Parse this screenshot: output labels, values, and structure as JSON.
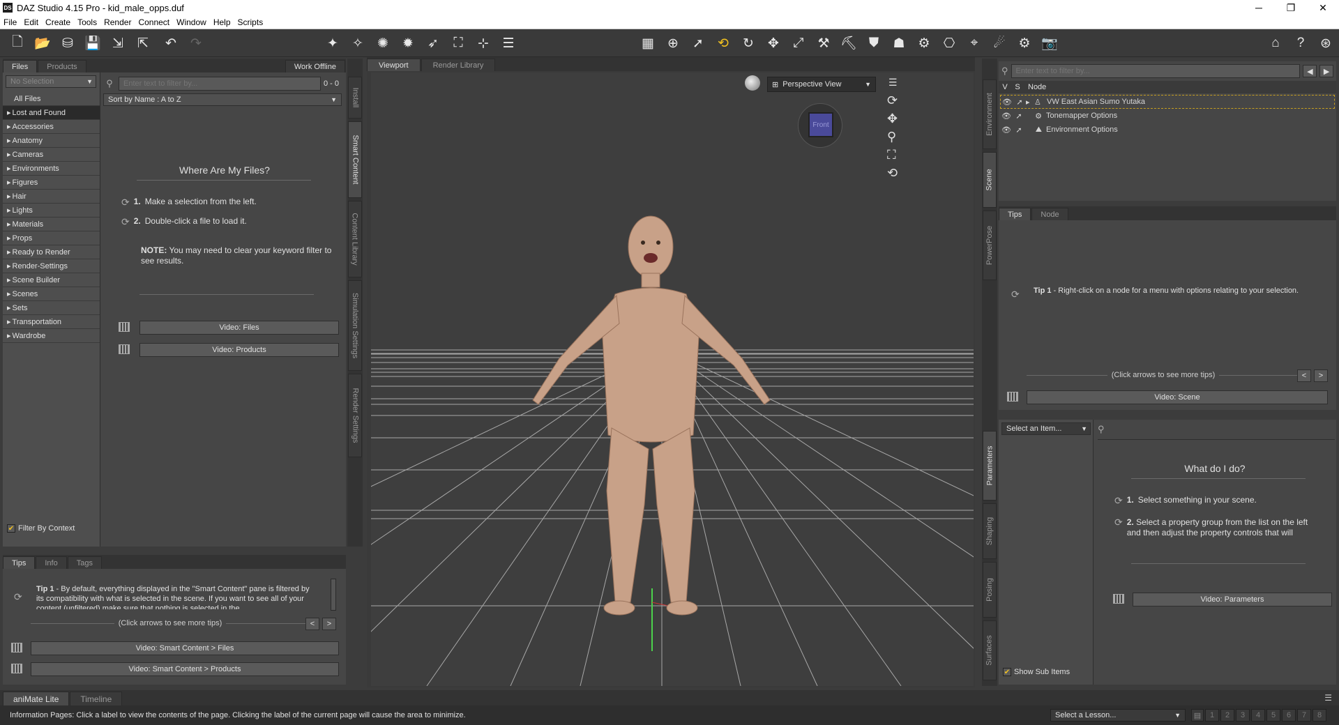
{
  "window": {
    "title": "DAZ Studio 4.15 Pro - kid_male_opps.duf",
    "app_badge": "DS",
    "minimize": "─",
    "restore": "❐",
    "close": "✕"
  },
  "menu": [
    "File",
    "Edit",
    "Create",
    "Tools",
    "Render",
    "Connect",
    "Window",
    "Help",
    "Scripts"
  ],
  "toolbar_icons": [
    "new-file-icon",
    "open-icon",
    "merge-icon",
    "save-icon",
    "import-icon",
    "export-icon",
    "undo-icon",
    "redo-icon",
    "create-figure-icon",
    "create-light-icon",
    "create-spot-icon",
    "create-point-icon",
    "create-distant-icon",
    "create-camera-icon",
    "create-null-icon",
    "align-icon",
    "scene-tool-icon",
    "rotate-icon",
    "select-tool-icon",
    "universal-tool-icon",
    "node-rotate-icon",
    "translate-icon",
    "scale-icon",
    "joint-editor-icon",
    "geometry-editor-icon",
    "surface-selection-icon",
    "weight-map-icon",
    "figure-setup-icon",
    "camera-icon",
    "region-nav-icon",
    "active-pose-icon",
    "render-settings-icon",
    "render-icon",
    "daz-connect-icon",
    "help-icon",
    "whats-this-icon"
  ],
  "left_panel": {
    "tabs": [
      "Files",
      "Products"
    ],
    "work_offline": "Work Offline",
    "selection": "No Selection",
    "filter_placeholder": "Enter text to filter by...",
    "count": "0 - 0",
    "sort": "Sort by Name : A to Z",
    "categories": [
      "All Files",
      "Lost and Found",
      "Accessories",
      "Anatomy",
      "Cameras",
      "Environments",
      "Figures",
      "Hair",
      "Lights",
      "Materials",
      "Props",
      "Ready to Render",
      "Render-Settings",
      "Scene Builder",
      "Scenes",
      "Sets",
      "Transportation",
      "Wardrobe"
    ],
    "where_title": "Where Are My Files?",
    "step1_num": "1.",
    "step1": "Make a selection from the left.",
    "step2_num": "2.",
    "step2": "Double-click a file to load it.",
    "note_label": "NOTE:",
    "note": "You may need to clear your keyword filter to see results.",
    "video_files": "Video: Files",
    "video_products": "Video:  Products",
    "filter_context": "Filter By Context",
    "side_tabs": [
      "Install",
      "Smart Content",
      "Content Library",
      "Simulation Settings",
      "Render Settings"
    ]
  },
  "left_bottom": {
    "tabs": [
      "Tips",
      "Info",
      "Tags"
    ],
    "tip_label": "Tip 1",
    "tip_text": " - By default, everything displayed in the \"Smart Content\" pane is filtered by its compatibility with what is selected in the scene. If you want to see all of your content (unfiltered) make sure that nothing is selected in the",
    "more_tips": "(Click arrows to see more tips)",
    "prev": "<",
    "next": ">",
    "video1": "Video: Smart Content > Files",
    "video2": "Video: Smart Content > Products"
  },
  "viewport": {
    "tabs": [
      "Viewport",
      "Render Library"
    ],
    "view_mode": "Perspective View",
    "cube_face": "Front"
  },
  "scene": {
    "filter_placeholder": "Enter text to filter by...",
    "cols": [
      "V",
      "S",
      "Node"
    ],
    "nodes": [
      "VW East Asian Sumo Yutaka",
      "Tonemapper Options",
      "Environment Options"
    ],
    "side_tabs": [
      "Environment",
      "Scene",
      "PowerPose"
    ],
    "tabs": [
      "Tips",
      "Node"
    ],
    "tip_label": "Tip 1",
    "tip_text": " - Right-click on a node for a menu with options relating to your selection.",
    "more_tips": "(Click arrows to see more tips)",
    "prev": "<",
    "next": ">",
    "video": "Video: Scene"
  },
  "params": {
    "select": "Select an Item...",
    "title": "What do I do?",
    "step1_num": "1.",
    "step1": "Select something in your scene.",
    "step2_num": "2.",
    "step2": "Select a property group from the list on the left and then adjust the property controls that will",
    "video": "Video: Parameters",
    "show_sub": "Show Sub Items",
    "side_tabs": [
      "Parameters",
      "Shaping",
      "Posing",
      "Surfaces"
    ]
  },
  "bottom": {
    "tabs": [
      "aniMate Lite",
      "Timeline"
    ],
    "info": "Information Pages: Click a label to view the contents of the page. Clicking the label of the current page will cause the area to minimize.",
    "lesson": "Select a Lesson...",
    "pages": [
      "1",
      "2",
      "3",
      "4",
      "5",
      "6",
      "7",
      "8"
    ]
  }
}
